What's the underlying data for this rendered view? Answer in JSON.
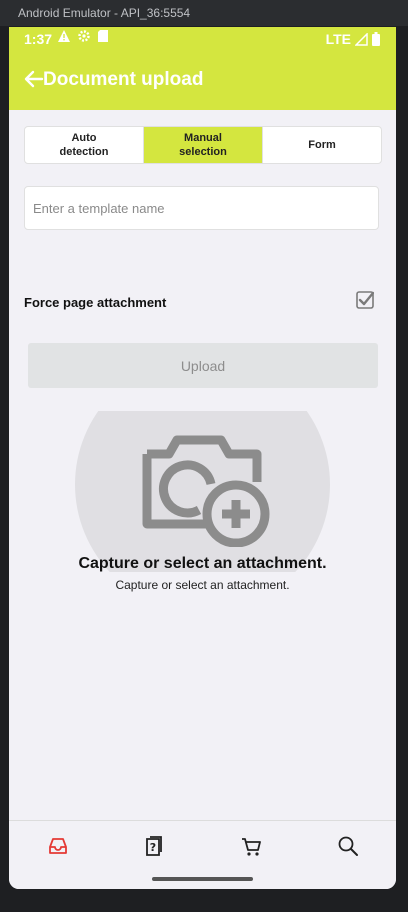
{
  "emulator": {
    "title": "Android Emulator - API_36:5554"
  },
  "status_bar": {
    "time": "1:37",
    "network": "LTE"
  },
  "app_bar": {
    "title": "Document upload",
    "back_icon": "arrow-left-icon"
  },
  "segments": [
    {
      "label": "Auto\ndetection",
      "active": false
    },
    {
      "label": "Manual\nselection",
      "active": true
    },
    {
      "label": "Form",
      "active": false
    }
  ],
  "template_input": {
    "placeholder": "Enter a template name",
    "value": ""
  },
  "force_attachment": {
    "label": "Force page attachment",
    "checked": true
  },
  "upload_button": {
    "label": "Upload",
    "enabled": false
  },
  "attachment": {
    "title": "Capture or select an attachment.",
    "subtitle": "Capture or select an attachment.",
    "icon": "camera-plus-icon"
  },
  "bottom_nav": [
    {
      "icon": "inbox-icon",
      "active": true
    },
    {
      "icon": "document-question-icon",
      "active": false
    },
    {
      "icon": "cart-icon",
      "active": false
    },
    {
      "icon": "search-icon",
      "active": false
    }
  ],
  "colors": {
    "accent": "#d4e63f",
    "active_nav": "#e53935",
    "background": "#f2f1f6"
  }
}
